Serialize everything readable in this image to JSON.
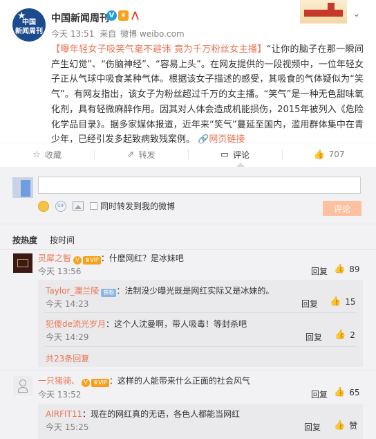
{
  "post": {
    "author": "中国新闻周刊",
    "avatar_text_line1": "中国",
    "avatar_text_line2": "新闻周刊",
    "time": "今天 13:51",
    "source_prefix": "来自",
    "source": "微博 weibo.com",
    "text_tag": "【曝年轻女子吸笑气毫不避讳 竟为千万粉丝女主播】",
    "text_body": "“让你的脑子在那一瞬间产生幻觉”、“伤脑神经”、“容易上头”。在网友提供的一段视频中，一位年轻女子正从气球中吸食某种气体。根据该女子描述的感受，其吸食的气体疑似为“笑气”。有网友指出，该女子为粉丝超过千万的女主播。“笑气”是一种无色甜味氧化剂，具有轻微麻醉作用。因其对人体会造成机能损伤，2015年被列入《危险化学品目录》。据多家媒体报道，近年来“笑气”蔓延至国内，滥用群体集中在青少年，已经引发多起致病致残案例。",
    "web_link_label": "网页链接"
  },
  "actions": {
    "favorite": "收藏",
    "forward": "转发",
    "comment": "评论",
    "like_count": "707"
  },
  "composer": {
    "input_value": "",
    "forward_checkbox_label": "同时转发到我的微博",
    "submit_label": "评论",
    "gif_label": "GIF"
  },
  "sort": {
    "hot": "按热度",
    "time": "按时间"
  },
  "comments": [
    {
      "name": "灵犀之智",
      "text": "：什麽网红？是冰妹吧",
      "time": "今天 13:56",
      "reply": "回复",
      "likes": "89",
      "replies": [
        {
          "name": "Taylor_瀾兰陵",
          "badge": "铁粉",
          "text": "：法制没少曝光既是网红实际又是冰妹的。",
          "time": "今天 14:23",
          "reply": "回复",
          "likes": "15"
        },
        {
          "name": "犯傻de流光岁月",
          "text": "：这个人沈曼啊，带人吸毒！等封杀吧",
          "time": "今天 14:29",
          "reply": "回复",
          "likes": "2"
        }
      ],
      "more": "共23条回复"
    },
    {
      "name": "一只猪骑、",
      "text": "：这样的人能带来什么正面的社会风气",
      "time": "今天 13:52",
      "reply": "回复",
      "likes": "65",
      "replies": [
        {
          "name": "AIRFIT11",
          "text": "：现在的网红真的无语，各色人都能当网红",
          "time": "今天 15:25",
          "reply": "回复",
          "likes": "赞"
        }
      ]
    }
  ],
  "colors": {
    "accent": "#eb7350",
    "verified_blue": "#1e9ddf",
    "vip_orange": "#f7a11a",
    "panel_bg": "#f2f2f5"
  }
}
